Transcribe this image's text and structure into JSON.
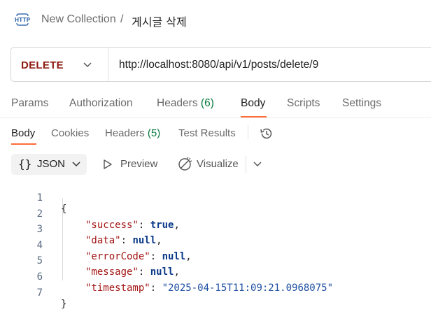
{
  "breadcrumb": {
    "icon": "http-request-icon",
    "collection": "New Collection",
    "separator": "/",
    "request_name": "게시글 삭제"
  },
  "request": {
    "method": "DELETE",
    "url": "http://localhost:8080/api/v1/posts/delete/9"
  },
  "request_tabs": [
    {
      "label": "Params"
    },
    {
      "label": "Authorization"
    },
    {
      "label": "Headers",
      "count": "(6)"
    },
    {
      "label": "Body",
      "active": true
    },
    {
      "label": "Scripts"
    },
    {
      "label": "Settings"
    }
  ],
  "response_tabs": [
    {
      "label": "Body",
      "active": true
    },
    {
      "label": "Cookies"
    },
    {
      "label": "Headers",
      "count": "(5)"
    },
    {
      "label": "Test Results"
    }
  ],
  "toolbar": {
    "format_braces": "{}",
    "format": "JSON",
    "preview": "Preview",
    "visualize": "Visualize"
  },
  "response_body": {
    "line_numbers": [
      "1",
      "2",
      "3",
      "4",
      "5",
      "6",
      "7"
    ],
    "open_brace": "{",
    "close_brace": "}",
    "fields": [
      {
        "key": "\"success\"",
        "value": "true",
        "value_type": "literal",
        "trail": ","
      },
      {
        "key": "\"data\"",
        "value": "null",
        "value_type": "literal",
        "trail": ","
      },
      {
        "key": "\"errorCode\"",
        "value": "null",
        "value_type": "literal",
        "trail": ","
      },
      {
        "key": "\"message\"",
        "value": "null",
        "value_type": "literal",
        "trail": ","
      },
      {
        "key": "\"timestamp\"",
        "value": "\"2025-04-15T11:09:21.0968075\"",
        "value_type": "string",
        "trail": ""
      }
    ]
  },
  "colors": {
    "method_delete": "#8e1a10",
    "active_tab_underline": "#ff6c37",
    "count_green": "#0a7b3e",
    "json_key": "#a31515",
    "json_literal": "#0b3a8a",
    "json_string": "#1f4fa3"
  }
}
